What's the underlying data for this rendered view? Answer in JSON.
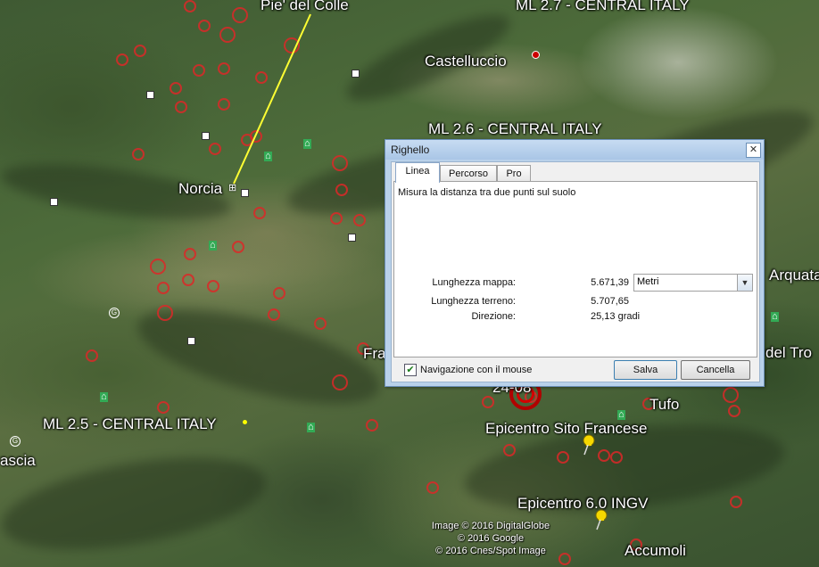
{
  "map": {
    "labels": {
      "pie_del_colle": "Pie' del Colle",
      "ml27": "ML 2.7 - CENTRAL ITALY",
      "castelluccio": "Castelluccio",
      "ml26": "ML 2.6 - CENTRAL ITALY",
      "norcia": "Norcia",
      "arquata": "Arquata",
      "del_tro": "del Tro",
      "fra": "Fra",
      "date_label": "24-08",
      "tufo": "Tufo",
      "ml25": "ML 2.5 - CENTRAL ITALY",
      "epicentro_sito": "Epicentro Sito Francese",
      "ascia": "ascia",
      "epicentro_ingv": "Epicentro 6.0 INGV",
      "accumoli": "Accumoli"
    },
    "credits": [
      "Image © 2016 DigitalGlobe",
      "© 2016 Google",
      "© 2016 Cnes/Spot Image"
    ],
    "colors": {
      "ruler_line": "#ffff33",
      "quake": "#dc2828",
      "pin": "#f5d800"
    }
  },
  "dialog": {
    "title": "Righello",
    "close_glyph": "✕",
    "tabs": [
      "Linea",
      "Percorso",
      "Pro"
    ],
    "active_tab": "Linea",
    "description": "Misura la distanza tra due punti sul suolo",
    "map_length_label": "Lunghezza mappa:",
    "map_length_value": "5.671,39",
    "unit": "Metri",
    "ground_length_label": "Lunghezza terreno:",
    "ground_length_value": "5.707,65",
    "direction_label": "Direzione:",
    "direction_value": "25,13 gradi",
    "mouse_nav_label": "Navigazione con il mouse",
    "mouse_nav_checked": true,
    "save_label": "Salva",
    "cancel_label": "Cancella"
  }
}
